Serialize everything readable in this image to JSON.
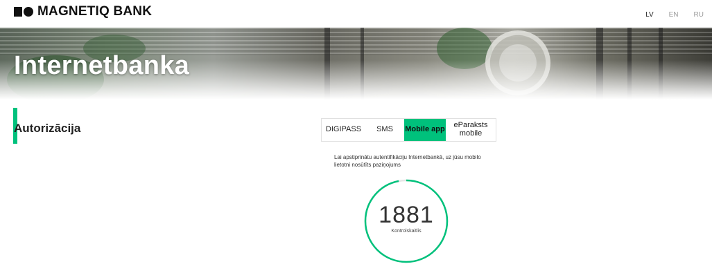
{
  "brand": {
    "name": "MAGNETIQ BANK",
    "accent_color": "#00c17c"
  },
  "languages": [
    {
      "code": "LV",
      "active": true
    },
    {
      "code": "EN",
      "active": false
    },
    {
      "code": "RU",
      "active": false
    }
  ],
  "hero": {
    "title": "Internetbanka"
  },
  "section": {
    "title": "Autorizācija"
  },
  "auth_tabs": [
    {
      "label": "DIGIPASS",
      "selected": false
    },
    {
      "label": "SMS",
      "selected": false
    },
    {
      "label": "Mobile app",
      "selected": true
    },
    {
      "label": "eParaksts mobile",
      "selected": false
    }
  ],
  "mobile_app": {
    "message": "Lai apstiprinātu autentifikāciju Internetbankā, uz jūsu mobilo lietotni nosūtīts paziņojums",
    "control_code": "1881",
    "control_code_label": "Kontrolskaitlis",
    "timer_progress": 0.97
  }
}
